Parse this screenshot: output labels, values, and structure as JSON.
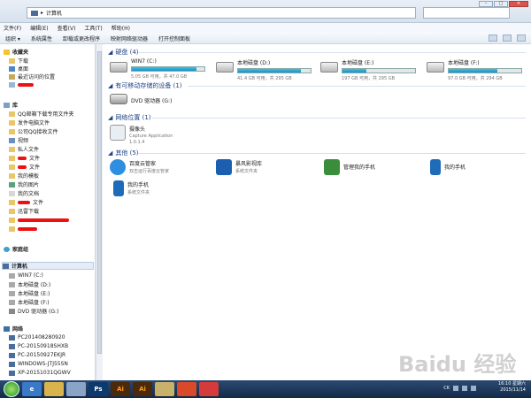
{
  "address": {
    "path": "计算机",
    "sep": "▸"
  },
  "menu": [
    "文件(F)",
    "编辑(E)",
    "查看(V)",
    "工具(T)",
    "帮助(H)"
  ],
  "toolbar": [
    "组织 ▾",
    "系统属性",
    "卸载或更改程序",
    "映射网络驱动器",
    "打开控制面板"
  ],
  "nav": {
    "favorites": {
      "label": "收藏夹",
      "items": [
        "下载",
        "桌面",
        "最近访问的位置"
      ]
    },
    "library": {
      "label": "库",
      "items": [
        "QQ邮箱下载专用文件夹",
        "发件电脑文件",
        "公司QQ接收文件",
        "视频",
        "私人文件",
        "文件",
        "文件",
        "我的模板",
        "我的图片",
        "我的文档",
        "文件",
        "迅雷下载"
      ]
    },
    "homegroup": {
      "label": "家庭组"
    },
    "computer": {
      "label": "计算机",
      "items": [
        "WIN7 (C:)",
        "本地磁盘 (D:)",
        "本地磁盘 (E:)",
        "本地磁盘 (F:)",
        "DVD 驱动器 (G:)"
      ]
    },
    "network": {
      "label": "网络",
      "items": [
        "PC201408280920",
        "PC-20150918SHXB",
        "PC-20150927EKJR",
        "WINDOWS-JTJ55SN",
        "XP-20151031QGWV"
      ]
    }
  },
  "sections": {
    "drives": "硬盘 (4)",
    "removable": "有可移动存储的设备 (1)",
    "network": "网络位置 (1)",
    "other": "其他 (5)"
  },
  "drives": [
    {
      "name": "WIN7 (C:)",
      "detail": "5.05 GB 可用，共 47.0 GB",
      "used": 0.89
    },
    {
      "name": "本地磁盘 (D:)",
      "detail": "41.4 GB 可用，共 295 GB",
      "used": 0.86
    },
    {
      "name": "本地磁盘 (E:)",
      "detail": "197 GB 可用，共 295 GB",
      "used": 0.33
    },
    {
      "name": "本地磁盘 (F:)",
      "detail": "97.0 GB 可用，共 294 GB",
      "used": 0.67
    }
  ],
  "dvd": {
    "name": "DVD 驱动器 (G:)"
  },
  "netloc": {
    "name": "摄像头",
    "sub1": "Capture Application",
    "sub2": "1.0.1.4"
  },
  "other": [
    {
      "name": "百度云管家",
      "sub": "双击运行百度云管家"
    },
    {
      "name": "暴风影视库",
      "sub": "系统文件夹"
    },
    {
      "name": "管理我的手机",
      "sub": ""
    },
    {
      "name": "我的手机",
      "sub": ""
    },
    {
      "name": "我的手机",
      "sub": "系统文件夹"
    }
  ],
  "taskbar": {
    "apps": [
      "Ps",
      "Ai",
      "Ai"
    ],
    "lang": "CK"
  },
  "clock": {
    "time": "16:10 星期六",
    "date": "2015/11/14"
  },
  "watermark": "Baidu 经验",
  "colors": {
    "accent": "#1d3f86",
    "bar": "#1b8fc0",
    "taskbar": "#132a48"
  }
}
